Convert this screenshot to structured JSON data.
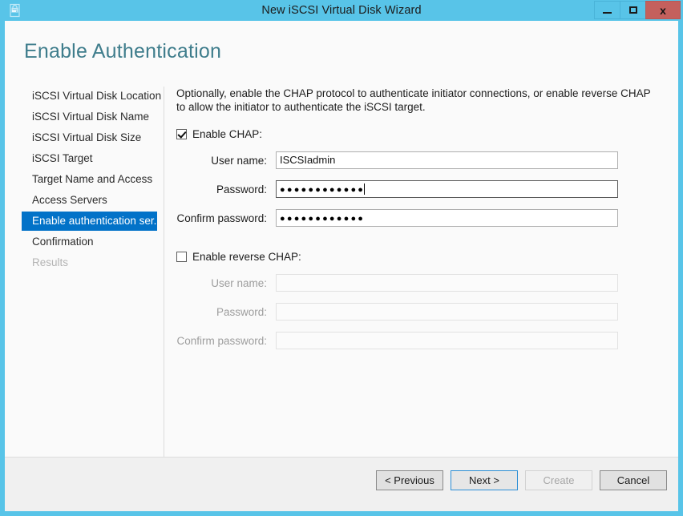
{
  "window": {
    "title": "New iSCSI Virtual Disk Wizard",
    "icon": "iscsi-disk-icon",
    "minimize_label": "Minimize",
    "maximize_label": "Maximize",
    "close_label": "x",
    "frame_color": "#58c4e8",
    "close_color": "#c4605d"
  },
  "page": {
    "title": "Enable Authentication",
    "title_color": "#3f7d8c"
  },
  "sidebar": {
    "items": [
      {
        "label": "iSCSI Virtual Disk Location",
        "state": "normal"
      },
      {
        "label": "iSCSI Virtual Disk Name",
        "state": "normal"
      },
      {
        "label": "iSCSI Virtual Disk Size",
        "state": "normal"
      },
      {
        "label": "iSCSI Target",
        "state": "normal"
      },
      {
        "label": "Target Name and Access",
        "state": "normal"
      },
      {
        "label": "Access Servers",
        "state": "normal"
      },
      {
        "label": "Enable authentication ser...",
        "state": "selected"
      },
      {
        "label": "Confirmation",
        "state": "normal"
      },
      {
        "label": "Results",
        "state": "disabled"
      }
    ],
    "selected_color": "#0272c8"
  },
  "main": {
    "description": "Optionally, enable the CHAP protocol to authenticate initiator connections, or enable reverse CHAP to allow the initiator to authenticate the iSCSI target.",
    "chap": {
      "checkbox_label": "Enable CHAP:",
      "checked": true,
      "fields": [
        {
          "label": "User name:",
          "value": "ISCSIadmin",
          "masked": false,
          "focused": false,
          "disabled": false
        },
        {
          "label": "Password:",
          "value": "............",
          "masked": true,
          "focused": true,
          "disabled": false
        },
        {
          "label": "Confirm password:",
          "value": "............",
          "masked": true,
          "focused": false,
          "disabled": false
        }
      ]
    },
    "reverse_chap": {
      "checkbox_label": "Enable reverse CHAP:",
      "checked": false,
      "fields": [
        {
          "label": "User name:",
          "value": "",
          "masked": false,
          "focused": false,
          "disabled": true
        },
        {
          "label": "Password:",
          "value": "",
          "masked": true,
          "focused": false,
          "disabled": true
        },
        {
          "label": "Confirm password:",
          "value": "",
          "masked": true,
          "focused": false,
          "disabled": true
        }
      ]
    }
  },
  "footer": {
    "buttons": [
      {
        "label": "< Previous",
        "state": "normal"
      },
      {
        "label": "Next >",
        "state": "default"
      },
      {
        "label": "Create",
        "state": "disabled"
      },
      {
        "label": "Cancel",
        "state": "normal"
      }
    ]
  }
}
